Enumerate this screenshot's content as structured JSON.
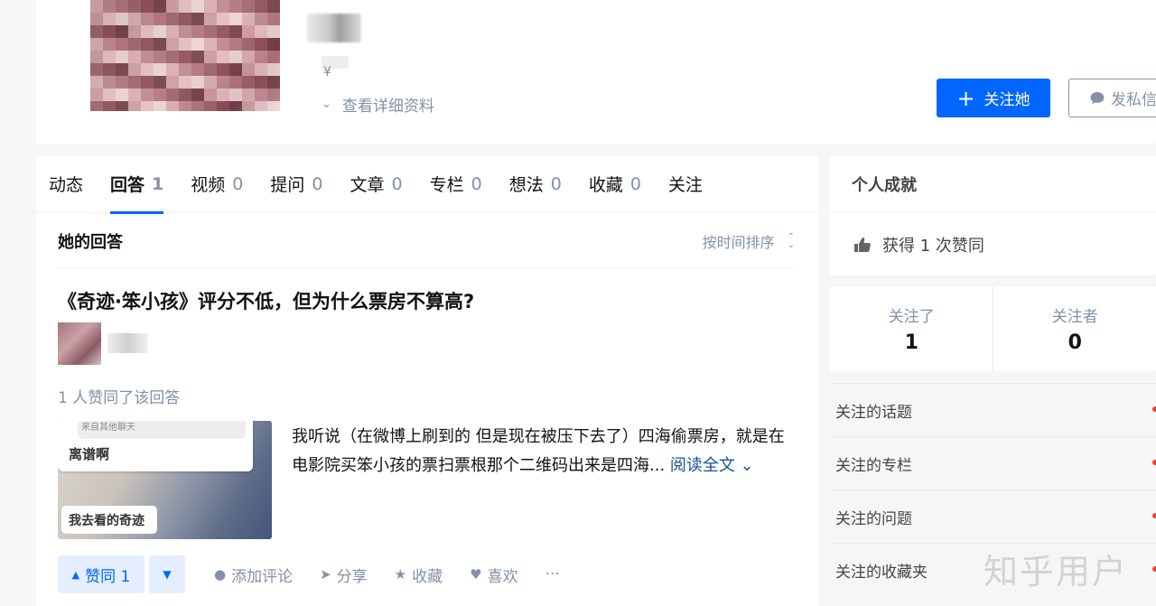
{
  "profile": {
    "detail_link": "查看详细资料",
    "follow_button": "关注她",
    "message_button": "发私信"
  },
  "tabs": [
    {
      "label": "动态",
      "count": ""
    },
    {
      "label": "回答",
      "count": "1"
    },
    {
      "label": "视频",
      "count": "0"
    },
    {
      "label": "提问",
      "count": "0"
    },
    {
      "label": "文章",
      "count": "0"
    },
    {
      "label": "专栏",
      "count": "0"
    },
    {
      "label": "想法",
      "count": "0"
    },
    {
      "label": "收藏",
      "count": "0"
    },
    {
      "label": "关注",
      "count": ""
    }
  ],
  "answers": {
    "section_title": "她的回答",
    "sort_label": "按时间排序",
    "item": {
      "question_title": "《奇迹·笨小孩》评分不低，但为什么票房不算高?",
      "upvote_info": "1 人赞同了该回答",
      "thumb_small_text": "来自其他聊天",
      "thumb_big_text": "离谱啊",
      "thumb_caption": "我去看的奇迹",
      "excerpt": "我听说（在微博上刷到的 但是现在被压下去了）四海偷票房，就是在电影院买笨小孩的票扫票根那个二维码出来是四海...",
      "read_more": "阅读全文",
      "vote_label": "赞同 1",
      "actions": {
        "comment": "添加评论",
        "share": "分享",
        "collect": "收藏",
        "like": "喜欢",
        "more": "···"
      }
    }
  },
  "achievements": {
    "title": "个人成就",
    "upvotes": "获得 1 次赞同"
  },
  "follow_stats": {
    "following_label": "关注了",
    "following_count": "1",
    "followers_label": "关注者",
    "followers_count": "0"
  },
  "sidebar_links": [
    "关注的话题",
    "关注的专栏",
    "关注的问题",
    "关注的收藏夹"
  ],
  "watermark": "知乎用户",
  "colors": {
    "brand_blue": "#0066ff",
    "muted": "#8590a6",
    "link_blue": "#175199"
  }
}
